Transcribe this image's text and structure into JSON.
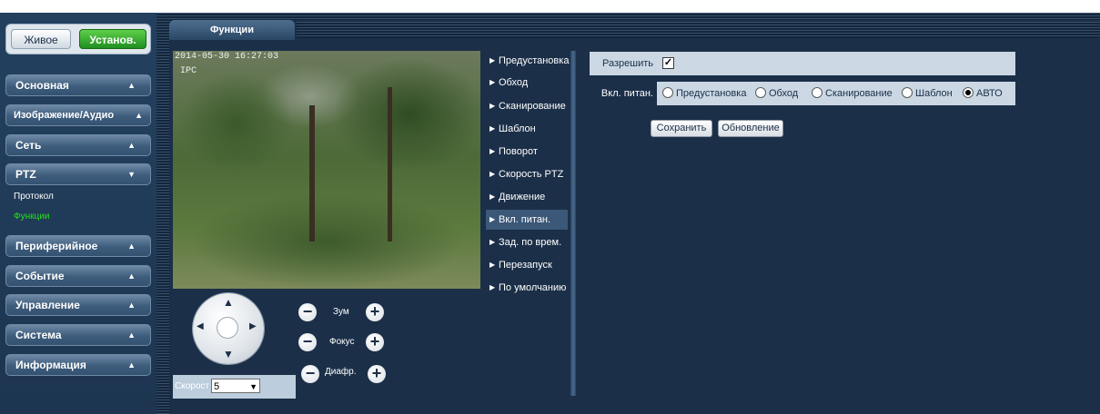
{
  "mode": {
    "live_label": "Живое",
    "setup_label": "Установ."
  },
  "sidebar": {
    "menu": [
      {
        "label": "Основная",
        "chevron": "▲"
      },
      {
        "label": "Изображение/Аудио",
        "chevron": "▲"
      },
      {
        "label": "Сеть",
        "chevron": "▲"
      },
      {
        "label": "PTZ",
        "chevron": "▼"
      },
      {
        "label": "Периферийное",
        "chevron": "▲"
      },
      {
        "label": "Событие",
        "chevron": "▲"
      },
      {
        "label": "Управление",
        "chevron": "▲"
      },
      {
        "label": "Система",
        "chevron": "▲"
      },
      {
        "label": "Информация",
        "chevron": "▲"
      }
    ],
    "ptz_sub": [
      {
        "label": "Протокол"
      },
      {
        "label": "Функции"
      }
    ]
  },
  "tab": {
    "label": "Функции"
  },
  "video": {
    "timestamp": "2014-05-30 16:27:03",
    "channel": "IPC"
  },
  "ptz": {
    "zoom_label": "Зум",
    "focus_label": "Фокус",
    "iris_label": "Диафр.",
    "speed_label": "Скорост",
    "speed_value": "5",
    "arrows": {
      "up": "▲",
      "down": "▼",
      "left": "◀",
      "right": "▶"
    }
  },
  "functions": [
    {
      "label": "Предустановка"
    },
    {
      "label": "Обход"
    },
    {
      "label": "Сканирование"
    },
    {
      "label": "Шаблон"
    },
    {
      "label": "Поворот"
    },
    {
      "label": "Скорость PTZ"
    },
    {
      "label": "Движение"
    },
    {
      "label": "Вкл. питан."
    },
    {
      "label": "Зад. по врем."
    },
    {
      "label": "Перезапуск"
    },
    {
      "label": "По умолчанию"
    }
  ],
  "settings": {
    "enable_label": "Разрешить",
    "enable_checked": "✓",
    "power_label": "Вкл. питан.",
    "options": [
      {
        "label": "Предустановка",
        "selected": false
      },
      {
        "label": "Обход",
        "selected": false
      },
      {
        "label": "Сканирование",
        "selected": false
      },
      {
        "label": "Шаблон",
        "selected": false
      },
      {
        "label": "АВТО",
        "selected": true
      }
    ],
    "save_label": "Сохранить",
    "refresh_label": "Обновление"
  },
  "colors": {
    "background": "#1b2f48",
    "accent_green": "#27e01d",
    "setup_green": "#1f8f20",
    "panel_light": "#cbd8e4"
  }
}
